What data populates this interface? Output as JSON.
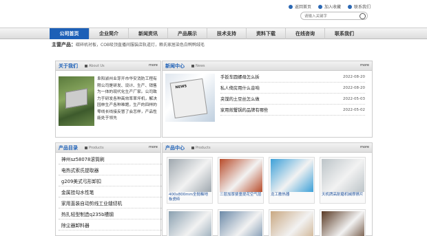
{
  "header": {
    "links": [
      "返回首页",
      "加入收藏",
      "联系我们"
    ],
    "search_placeholder": "请输入关键字"
  },
  "nav": {
    "items": [
      "公司首页",
      "企业简介",
      "新闻资讯",
      "产品展示",
      "技术支持",
      "资料下载",
      "在线咨询",
      "联系我们"
    ],
    "active_index": 0
  },
  "keywords": {
    "label": "主营产品：",
    "text": "碳碎机衬板，COB吸顶直播间服装店轨道灯，赖氏家居染色白鸭鸭绒毛"
  },
  "about": {
    "title": "关于我们",
    "subtitle": "About Us",
    "more": "more",
    "text": "阜阳颍州业芽开市华安消防工程有限公司是研发、设计、生产、销售为一体的现代化生产厂家。公司致力于研发各种高效率草坪机，解决园林生产各种难题，生产的四样的零线长线接反冒了会怎样，产品性能处于领先"
  },
  "news": {
    "title": "新闻中心",
    "subtitle": "News",
    "more": "more",
    "items": [
      {
        "title": "手扳车圆螺母怎么拆",
        "date": "2022-08-20"
      },
      {
        "title": "私人倚房用什么音响",
        "date": "2022-08-20"
      },
      {
        "title": "夹馍的土豆丝怎么做",
        "date": "2022-05-03"
      },
      {
        "title": "家用煎蟹锅的品牌有哪些",
        "date": "2022-05-02"
      }
    ]
  },
  "categories": {
    "title": "产品目录",
    "subtitle": "Products",
    "more": "more",
    "items": [
      "神州sz58078滚筒刷",
      "电热式索氏提取器",
      "g209美式弓形卸扣",
      "金属挂勾水性笔",
      "家用直装自动剪线工业缝纫机",
      "热扎轻型制造q235b槽钢",
      "除尘器卸料器"
    ]
  },
  "products": {
    "title": "产品中心",
    "subtitle": "Products",
    "more": "more",
    "items": [
      {
        "name": "400x800mm全抛釉地板瓷砖",
        "color": "#9ea7ae"
      },
      {
        "name": "三层加厚婴童提花空气层",
        "color": "#b84b2a"
      },
      {
        "name": "龙工散热器",
        "color": "#3ca0d8"
      },
      {
        "name": "天机牌高耐磨机械摩擦片",
        "color": "#bcc4c8"
      },
      {
        "name": "",
        "color": "#8aa0b0"
      },
      {
        "name": "",
        "color": "#6c8aa8"
      },
      {
        "name": "",
        "color": "#c9a882"
      },
      {
        "name": "",
        "color": "#5a3a24"
      }
    ]
  }
}
